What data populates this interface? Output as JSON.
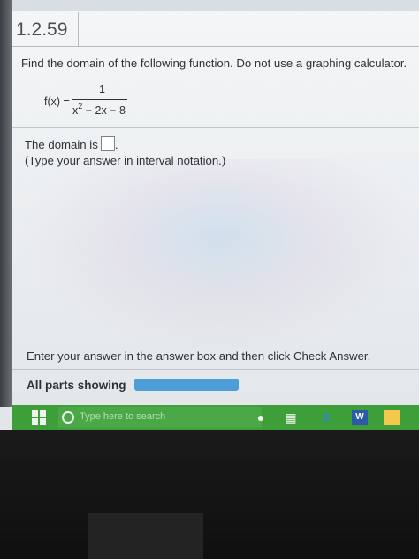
{
  "problem": {
    "number": "1.2.59",
    "instruction": "Find the domain of the following function. Do not use a graphing calculator.",
    "function_label": "f(x) =",
    "numerator": "1",
    "denominator_base": "x",
    "denominator_exponent": "2",
    "denominator_rest": " − 2x − 8",
    "answer_prompt_before": "The domain is",
    "answer_prompt_after": ".",
    "answer_value": "",
    "hint": "(Type your answer in interval notation.)"
  },
  "footer": {
    "message": "Enter your answer in the answer box and then click Check Answer.",
    "parts_label": "All parts showing",
    "progress_fraction": 1.0
  },
  "taskbar": {
    "search_placeholder": "Type here to search",
    "icons": [
      "windows-start-icon",
      "search-icon",
      "microphone-icon",
      "task-view-icon",
      "edge-browser-icon",
      "word-icon",
      "file-explorer-icon"
    ],
    "accent_color": "#3e9e3a"
  }
}
